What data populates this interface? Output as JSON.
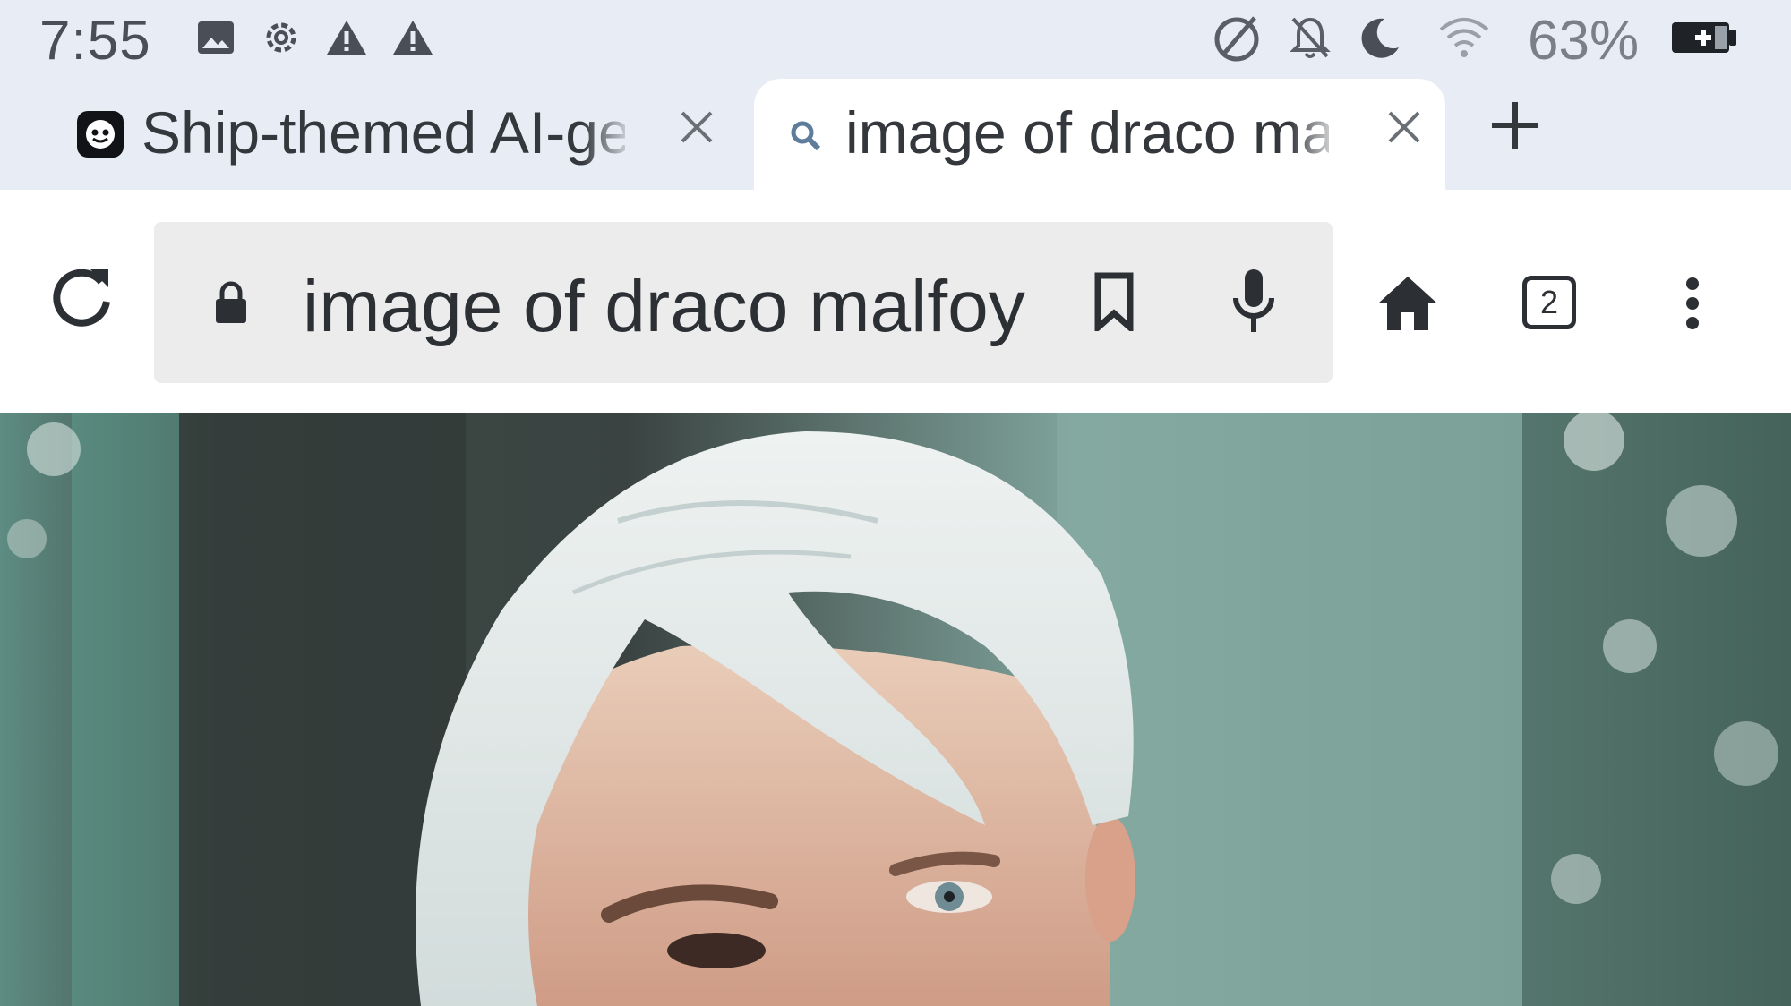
{
  "status_bar": {
    "time": "7:55",
    "battery_percent": "63%",
    "icons": [
      "image-notification-icon",
      "settings-notification-icon",
      "warning-icon",
      "warning-icon",
      "data-saver-icon",
      "notifications-off-icon",
      "do-not-disturb-icon",
      "wifi-icon",
      "battery-charging-icon"
    ]
  },
  "tabs": [
    {
      "title": "Ship-themed AI-gen",
      "active": false,
      "favicon": "app-logo-icon"
    },
    {
      "title": "image of draco mal",
      "active": true,
      "favicon": "search-icon"
    }
  ],
  "toolbar": {
    "url": "image of draco malfoy",
    "tab_count": "2"
  },
  "colors": {
    "chrome_bg": "#e8ecf5",
    "omnibox_bg": "#ececec",
    "text": "#3c4043",
    "accent": "#5f7c9b"
  }
}
